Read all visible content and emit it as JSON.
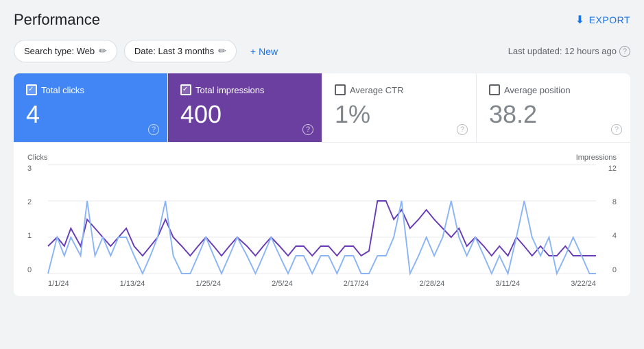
{
  "page": {
    "title": "Performance",
    "export_label": "EXPORT",
    "last_updated": "Last updated: 12 hours ago"
  },
  "toolbar": {
    "search_type_label": "Search type: Web",
    "date_label": "Date: Last 3 months",
    "new_label": "New",
    "plus_symbol": "+"
  },
  "metrics": [
    {
      "id": "total-clicks",
      "label": "Total clicks",
      "value": "4",
      "active": true,
      "color": "blue",
      "checked": true
    },
    {
      "id": "total-impressions",
      "label": "Total impressions",
      "value": "400",
      "active": true,
      "color": "purple",
      "checked": true
    },
    {
      "id": "average-ctr",
      "label": "Average CTR",
      "value": "1%",
      "active": false,
      "color": "gray",
      "checked": false
    },
    {
      "id": "average-position",
      "label": "Average position",
      "value": "38.2",
      "active": false,
      "color": "gray",
      "checked": false
    }
  ],
  "chart": {
    "left_axis_label": "Clicks",
    "right_axis_label": "Impressions",
    "y_left_values": [
      "0",
      "1",
      "2",
      "3"
    ],
    "y_right_values": [
      "0",
      "4",
      "8",
      "12"
    ],
    "x_labels": [
      "1/1/24",
      "1/13/24",
      "1/25/24",
      "2/5/24",
      "2/17/24",
      "2/28/24",
      "3/11/24",
      "3/22/24"
    ],
    "blue_line_color": "#8ab4f8",
    "purple_line_color": "#673ab7"
  },
  "icons": {
    "download": "⬇",
    "pencil": "✏",
    "help": "?",
    "check": "✓",
    "plus": "+"
  }
}
